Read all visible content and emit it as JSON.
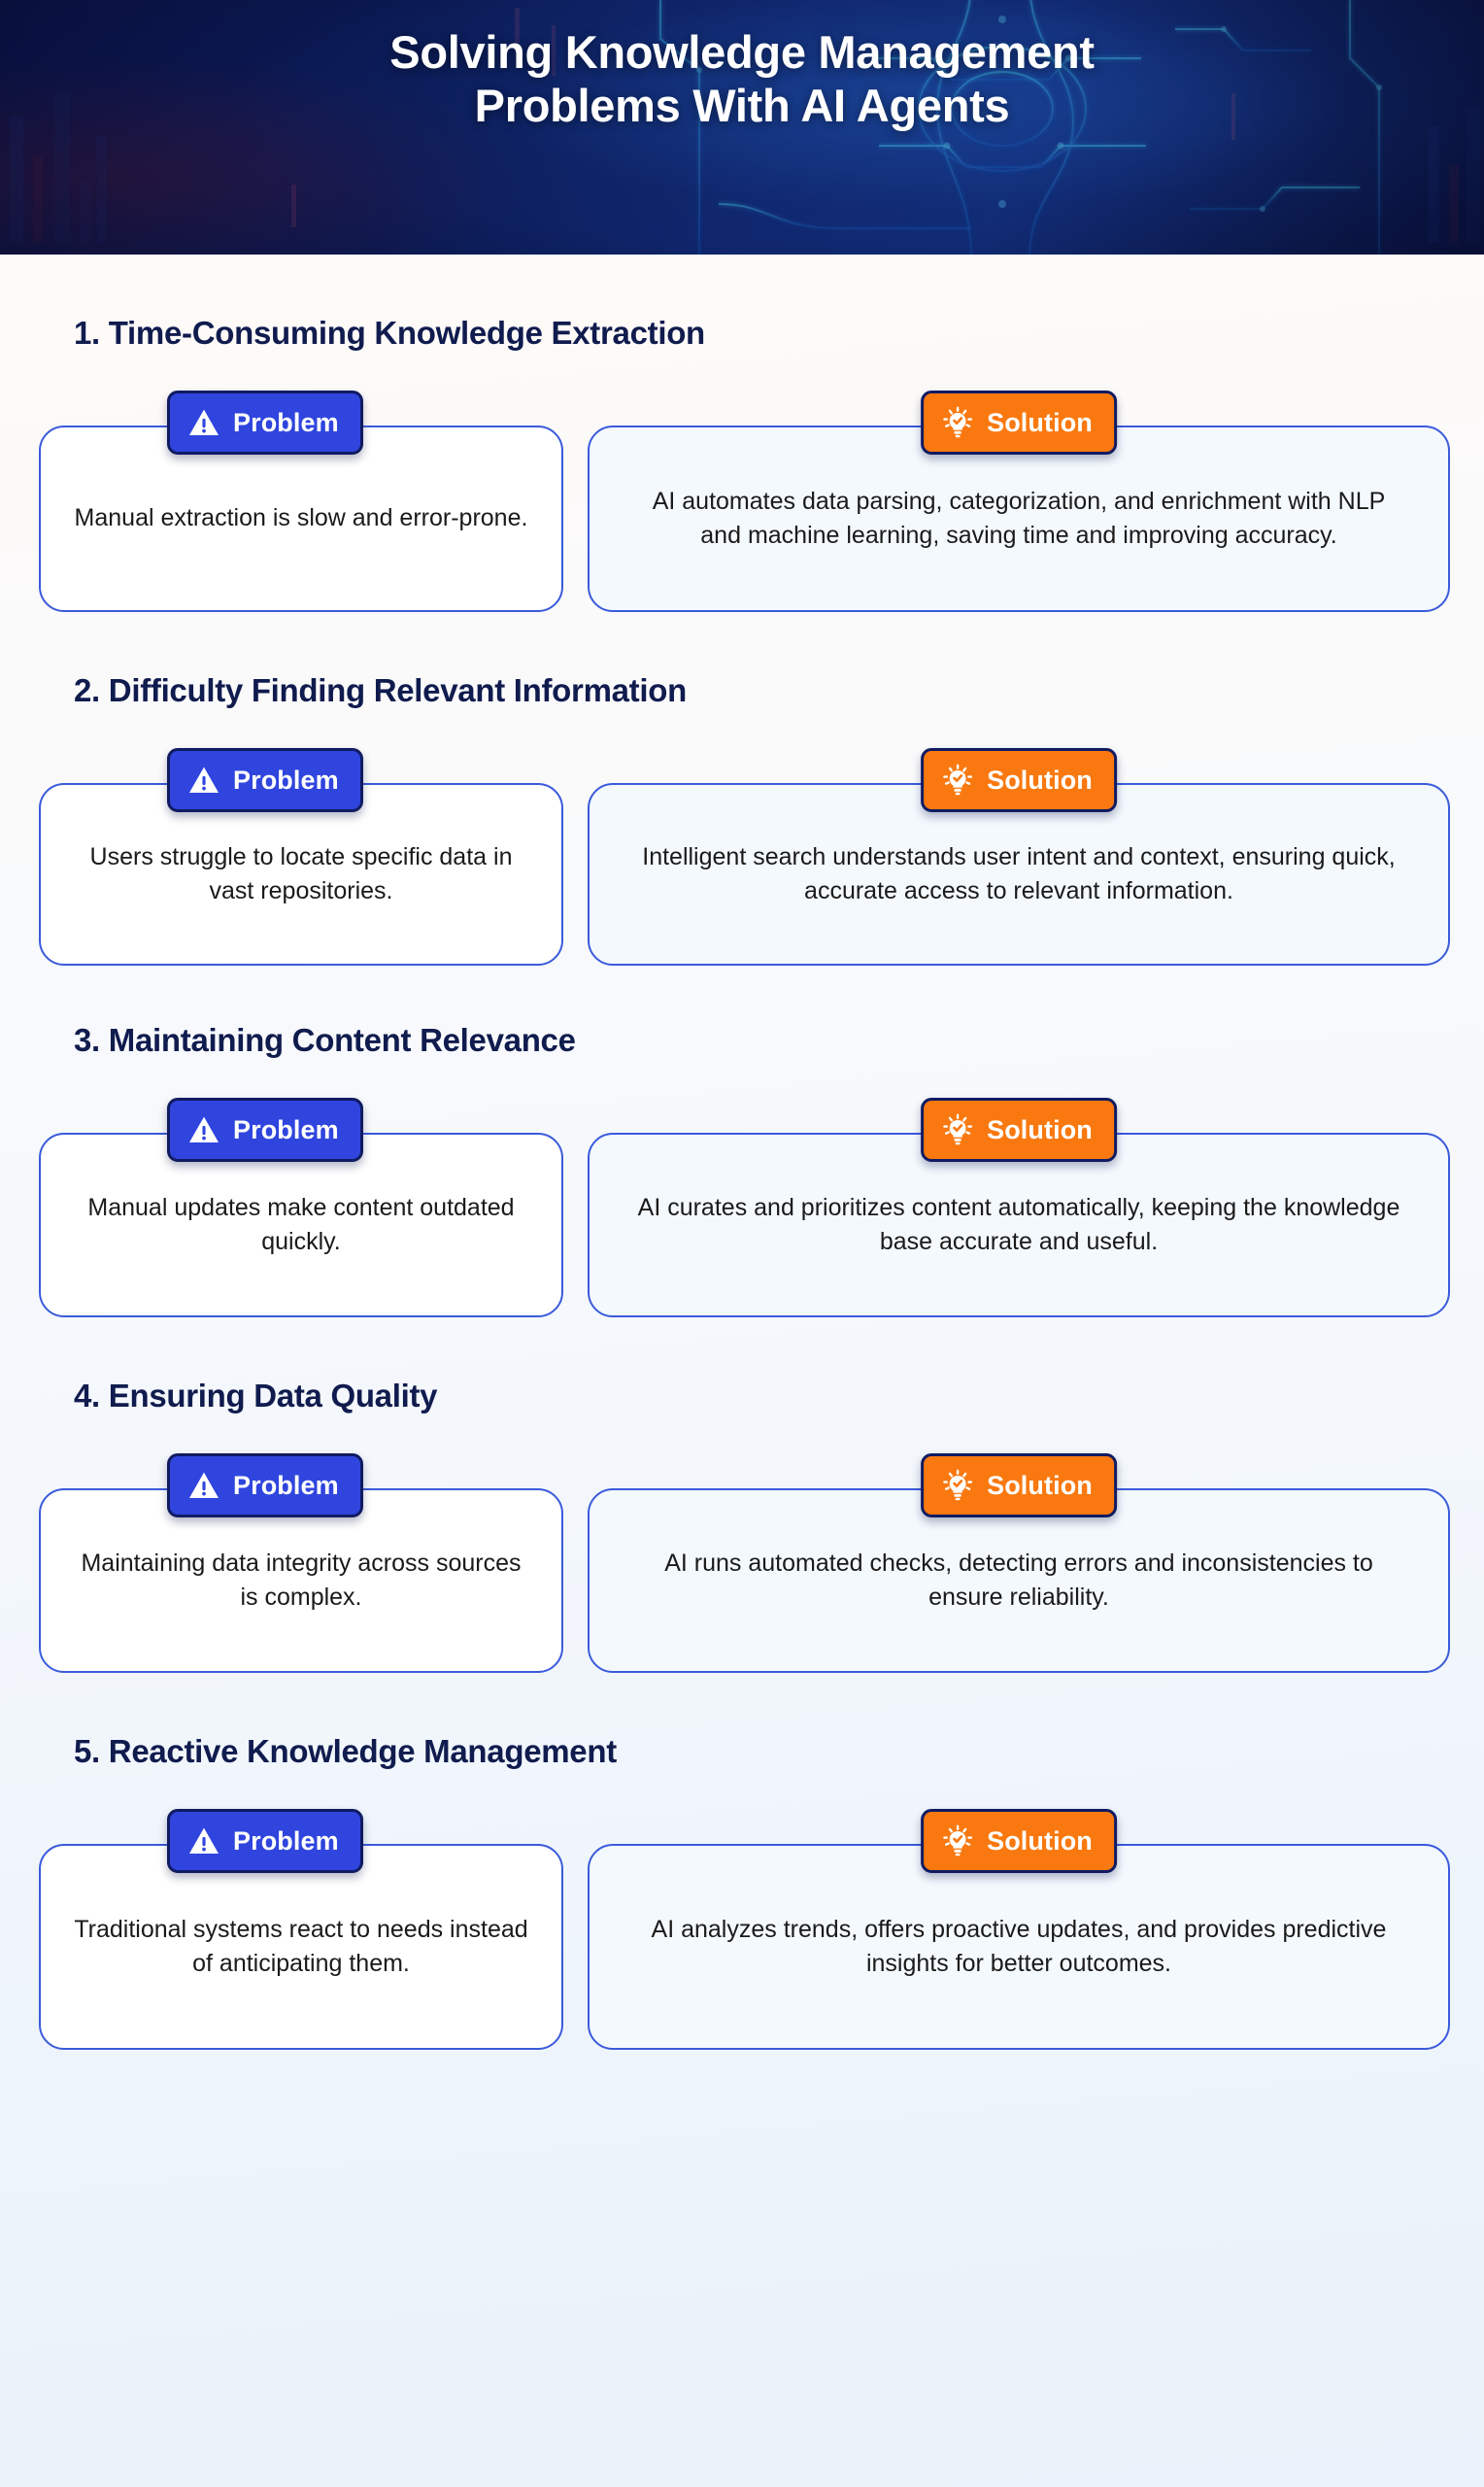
{
  "header": {
    "title_line1": "Solving Knowledge Management",
    "title_line2": "Problems With AI Agents",
    "background_color": "#0D1B5E",
    "title_color": "#FFFFFF"
  },
  "theme": {
    "problem_badge_color": "#2F45DE",
    "solution_badge_color": "#F97910",
    "badge_border_color": "#101B62",
    "card_border_color": "#3B5BDB",
    "problem_card_bg": "#FFFFFF",
    "solution_card_bg": "#F4F9FE",
    "section_title_color": "#101B4E",
    "page_bg_top": "#FEFAF7",
    "page_bg_bottom": "#E9F2FA"
  },
  "labels": {
    "problem": "Problem",
    "solution": "Solution",
    "problem_icon": "warning-triangle-icon",
    "solution_icon": "lightbulb-check-icon"
  },
  "sections": [
    {
      "number": "1.",
      "title": "1. Time-Consuming Knowledge Extraction",
      "problem": "Manual extraction is slow and error-prone.",
      "solution": "AI automates data parsing, categorization, and enrichment with NLP and machine learning, saving time and improving accuracy."
    },
    {
      "number": "2.",
      "title": "2. Difficulty Finding Relevant Information",
      "problem": "Users struggle to locate specific data in vast repositories.",
      "solution": "Intelligent search understands user intent and context, ensuring quick, accurate access to relevant information."
    },
    {
      "number": "3.",
      "title": "3. Maintaining Content Relevance",
      "problem": "Manual updates make content outdated quickly.",
      "solution": "AI curates and prioritizes content automatically, keeping the knowledge base accurate and useful."
    },
    {
      "number": "4.",
      "title": "4. Ensuring Data Quality",
      "problem": "Maintaining data integrity across sources is complex.",
      "solution": "AI runs automated checks, detecting errors and inconsistencies to ensure reliability."
    },
    {
      "number": "5.",
      "title": "5. Reactive Knowledge Management",
      "problem": "Traditional systems react to needs instead of anticipating them.",
      "solution": "AI analyzes trends, offers proactive updates, and provides predictive insights for better outcomes."
    }
  ]
}
